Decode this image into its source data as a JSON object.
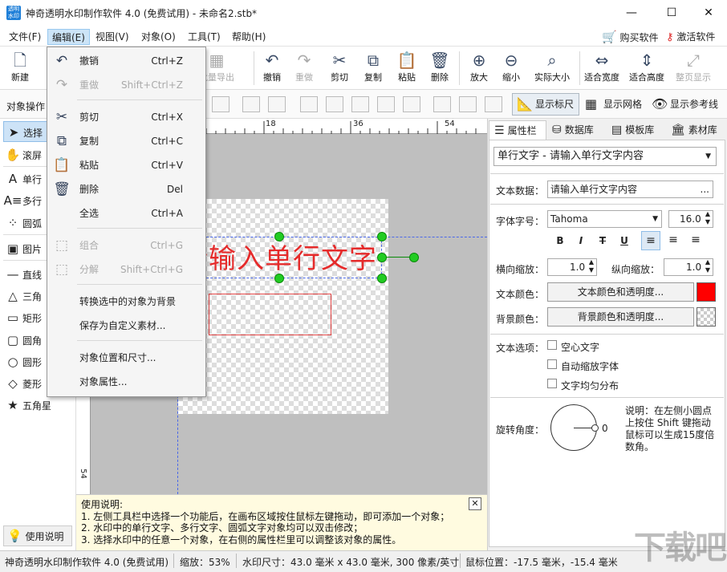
{
  "window": {
    "title": "神奇透明水印制作软件 4.0 (免费试用) - 未命名2.stb*",
    "icon_text": "透明水印",
    "controls": {
      "minimize": "—",
      "maximize": "☐",
      "close": "✕"
    }
  },
  "menubar": {
    "items": [
      "文件(F)",
      "编辑(E)",
      "视图(V)",
      "对象(O)",
      "工具(T)",
      "帮助(H)"
    ],
    "active": "编辑(E)",
    "buy": "购买软件",
    "activate": "激活软件"
  },
  "toolbar": {
    "items": [
      {
        "label": "新建",
        "icon": "new-file-icon",
        "glyph": "🗋",
        "enabled": true
      },
      {
        "label": "批量导出",
        "icon": "batch-export-icon",
        "glyph": "▦",
        "enabled": false
      },
      {
        "label": "撤销",
        "icon": "undo-icon",
        "glyph": "↶",
        "enabled": true
      },
      {
        "label": "重做",
        "icon": "redo-icon",
        "glyph": "↷",
        "enabled": false
      },
      {
        "label": "剪切",
        "icon": "cut-icon",
        "glyph": "✂",
        "enabled": true
      },
      {
        "label": "复制",
        "icon": "copy-icon",
        "glyph": "⧉",
        "enabled": true
      },
      {
        "label": "粘贴",
        "icon": "paste-icon",
        "glyph": "📋",
        "enabled": true
      },
      {
        "label": "删除",
        "icon": "trash-icon",
        "glyph": "🗑",
        "enabled": true
      },
      {
        "label": "放大",
        "icon": "zoom-in-icon",
        "glyph": "⊕",
        "enabled": true
      },
      {
        "label": "缩小",
        "icon": "zoom-out-icon",
        "glyph": "⊖",
        "enabled": true
      },
      {
        "label": "实际大小",
        "icon": "actual-size-icon",
        "glyph": "⌕",
        "enabled": true
      },
      {
        "label": "适合宽度",
        "icon": "fit-width-icon",
        "glyph": "⇔",
        "enabled": true
      },
      {
        "label": "适合高度",
        "icon": "fit-height-icon",
        "glyph": "⇕",
        "enabled": true
      },
      {
        "label": "整页显示",
        "icon": "full-page-icon",
        "glyph": "⤢",
        "enabled": false
      }
    ]
  },
  "toolbar2": {
    "object_ops_label": "对象操作",
    "show_ruler": "显示标尺",
    "show_grid": "显示网格",
    "show_guides": "显示参考线"
  },
  "left_tools": [
    {
      "label": "选择",
      "glyph": "➤",
      "icon": "pointer-icon"
    },
    {
      "label": "滚屏",
      "glyph": "✋",
      "icon": "hand-icon"
    },
    {
      "label": "单行",
      "glyph": "A",
      "icon": "single-line-text-icon"
    },
    {
      "label": "多行",
      "glyph": "A≡",
      "icon": "multi-line-text-icon"
    },
    {
      "label": "圆弧",
      "glyph": "⁘",
      "icon": "arc-text-icon"
    },
    {
      "label": "图片",
      "glyph": "▣",
      "icon": "image-icon"
    },
    {
      "label": "直线",
      "glyph": "—",
      "icon": "line-icon"
    },
    {
      "label": "三角",
      "glyph": "△",
      "icon": "triangle-icon"
    },
    {
      "label": "矩形",
      "glyph": "▭",
      "icon": "rectangle-icon"
    },
    {
      "label": "圆角",
      "glyph": "▢",
      "icon": "rounded-rect-icon"
    },
    {
      "label": "圆形",
      "glyph": "○",
      "icon": "circle-icon"
    },
    {
      "label": "菱形",
      "glyph": "◇",
      "icon": "diamond-icon"
    },
    {
      "label": "五角星",
      "glyph": "★",
      "icon": "star-icon"
    }
  ],
  "help_button": "使用说明",
  "ruler": {
    "top_ticks": [
      "18",
      "36",
      "54"
    ],
    "left_ticks": [
      "54"
    ]
  },
  "canvas": {
    "watermark_text": "请输入单行文字"
  },
  "instructions": {
    "title": "使用说明:",
    "lines": [
      "1. 左侧工具栏中选择一个功能后，在画布区域按住鼠标左键拖动，即可添加一个对象；",
      "2. 水印中的单行文字、多行文字、圆弧文字对象均可以双击修改；",
      "3. 选择水印中的任意一个对象，在右侧的属性栏里可以调整该对象的属性。"
    ],
    "close": "✕"
  },
  "right_panel": {
    "tabs": [
      "属性栏",
      "数据库",
      "模板库",
      "素材库"
    ],
    "object_select": "单行文字 - 请输入单行文字内容",
    "text_data_label": "文本数据：",
    "text_data_value": "请输入单行文字内容",
    "font_label": "字体字号：",
    "font_name": "Tahoma",
    "font_size": "16.0",
    "format_buttons": [
      "B",
      "I",
      "T",
      "U"
    ],
    "h_scale_label": "横向缩放：",
    "h_scale_value": "1.0",
    "v_scale_label": "纵向缩放：",
    "v_scale_value": "1.0",
    "text_color_label": "文本颜色：",
    "text_color_button": "文本颜色和透明度...",
    "text_color": "#ff0000",
    "bg_color_label": "背景颜色：",
    "bg_color_button": "背景颜色和透明度...",
    "text_options_label": "文本选项：",
    "options": [
      "空心文字",
      "自动缩放字体",
      "文字均匀分布"
    ],
    "rotate_label": "旋转角度：",
    "rotate_value": "0",
    "rotate_note": [
      "说明：在左侧小圆点",
      "上按住 Shift 键拖动",
      "鼠标可以生成15度倍",
      "数角。"
    ]
  },
  "statusbar": {
    "app": "神奇透明水印制作软件 4.0 (免费试用)",
    "zoom": "缩放：53%",
    "size": "水印尺寸：43.0 毫米 x 43.0 毫米, 300 像素/英寸",
    "mouse": "鼠标位置：-17.5 毫米，-15.4 毫米"
  },
  "edit_menu": {
    "items": [
      {
        "label": "撤销",
        "shortcut": "Ctrl+Z",
        "glyph": "↶",
        "icon": "undo-icon",
        "enabled": true
      },
      {
        "label": "重做",
        "shortcut": "Shift+Ctrl+Z",
        "glyph": "↷",
        "icon": "redo-icon",
        "enabled": false
      },
      {
        "label": "剪切",
        "shortcut": "Ctrl+X",
        "glyph": "✂",
        "icon": "cut-icon",
        "enabled": true
      },
      {
        "label": "复制",
        "shortcut": "Ctrl+C",
        "glyph": "⧉",
        "icon": "copy-icon",
        "enabled": true
      },
      {
        "label": "粘贴",
        "shortcut": "Ctrl+V",
        "glyph": "📋",
        "icon": "paste-icon",
        "enabled": true
      },
      {
        "label": "删除",
        "shortcut": "Del",
        "glyph": "🗑",
        "icon": "trash-icon",
        "enabled": true
      },
      {
        "label": "全选",
        "shortcut": "Ctrl+A",
        "glyph": "",
        "icon": "",
        "enabled": true
      },
      {
        "label": "组合",
        "shortcut": "Ctrl+G",
        "glyph": "⬚",
        "icon": "group-icon",
        "enabled": false
      },
      {
        "label": "分解",
        "shortcut": "Shift+Ctrl+G",
        "glyph": "⬚",
        "icon": "ungroup-icon",
        "enabled": false
      },
      {
        "label": "转换选中的对象为背景",
        "shortcut": "",
        "glyph": "",
        "icon": "",
        "enabled": true
      },
      {
        "label": "保存为自定义素材...",
        "shortcut": "",
        "glyph": "",
        "icon": "",
        "enabled": true
      },
      {
        "label": "对象位置和尺寸...",
        "shortcut": "",
        "glyph": "",
        "icon": "",
        "enabled": true
      },
      {
        "label": "对象属性...",
        "shortcut": "",
        "glyph": "",
        "icon": "",
        "enabled": true
      }
    ]
  },
  "brand_mark": "下载吧"
}
